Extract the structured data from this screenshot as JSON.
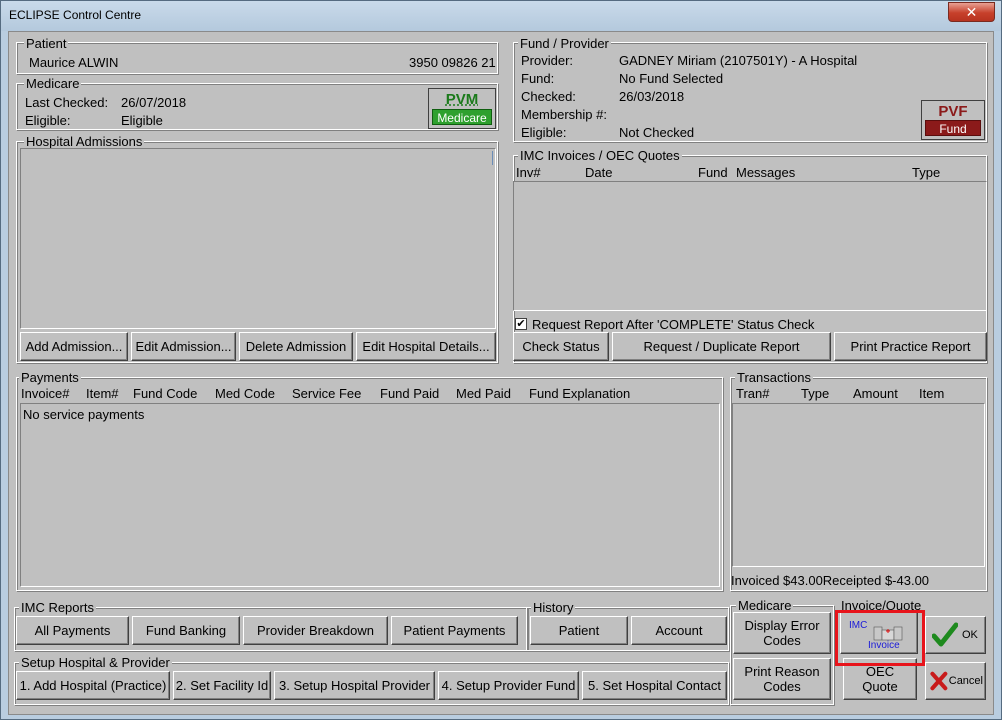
{
  "window": {
    "title": "ECLIPSE Control Centre",
    "close_glyph": "✕"
  },
  "patient": {
    "label": "Patient",
    "name": "Maurice ALWIN",
    "number": "3950 09826 21"
  },
  "medicare": {
    "label": "Medicare",
    "last_checked_label": "Last Checked:",
    "last_checked_value": "26/07/2018",
    "eligible_label": "Eligible:",
    "eligible_value": "Eligible",
    "pvm_big": "PVM",
    "pvm_small": "Medicare"
  },
  "fund_provider": {
    "label": "Fund / Provider",
    "rows": [
      {
        "label": "Provider:",
        "value": "GADNEY Miriam (2107501Y) - A Hospital"
      },
      {
        "label": "Fund:",
        "value": "No Fund Selected"
      },
      {
        "label": "Checked:",
        "value": "26/03/2018"
      },
      {
        "label": "Membership #:",
        "value": ""
      },
      {
        "label": "Eligible:",
        "value": "Not Checked"
      }
    ],
    "pvf_big": "PVF",
    "pvf_small": "Fund"
  },
  "hospital_admissions": {
    "label": "Hospital Admissions",
    "buttons": [
      "Add Admission...",
      "Edit Admission...",
      "Delete Admission",
      "Edit Hospital Details..."
    ]
  },
  "imc_invoices": {
    "label": "IMC Invoices / OEC Quotes",
    "columns": [
      "Inv#",
      "Date",
      "Fund",
      "Messages",
      "Type"
    ],
    "request_report_label": "Request Report After 'COMPLETE' Status Check",
    "buttons": [
      "Check Status",
      "Request / Duplicate Report",
      "Print Practice Report"
    ]
  },
  "payments": {
    "label": "Payments",
    "columns": [
      "Invoice#",
      "Item#",
      "Fund Code",
      "Med Code",
      "Service Fee",
      "Fund Paid",
      "Med Paid",
      "Fund Explanation"
    ],
    "empty_text": "No service payments"
  },
  "transactions": {
    "label": "Transactions",
    "columns": [
      "Tran#",
      "Type",
      "Amount",
      "Item"
    ],
    "footer": "Invoiced $43.00Receipted $-43.00"
  },
  "imc_reports": {
    "label": "IMC Reports",
    "buttons": [
      "All Payments",
      "Fund Banking",
      "Provider Breakdown",
      "Patient Payments"
    ]
  },
  "history": {
    "label": "History",
    "buttons": [
      "Patient",
      "Account"
    ]
  },
  "setup": {
    "label": "Setup Hospital & Provider",
    "buttons": [
      "1. Add Hospital (Practice)",
      "2. Set Facility Id",
      "3. Setup Hospital Provider",
      "4. Setup Provider Fund",
      "5. Set Hospital Contact"
    ]
  },
  "medicare_box": {
    "label": "Medicare",
    "display_error_l1": "Display Error",
    "display_error_l2": "Codes",
    "print_reason_l1": "Print Reason",
    "print_reason_l2": "Codes"
  },
  "invoice_quote": {
    "label": "Invoice/Quote",
    "imc_top": "IMC",
    "imc_bottom": "Invoice",
    "oec_l1": "OEC",
    "oec_l2": "Quote"
  },
  "ok_label": "OK",
  "cancel_label": "Cancel",
  "colors": {
    "highlight": "#e8141b",
    "pvm_green": "#2ea02e",
    "pvf_red": "#8b1a1a"
  }
}
